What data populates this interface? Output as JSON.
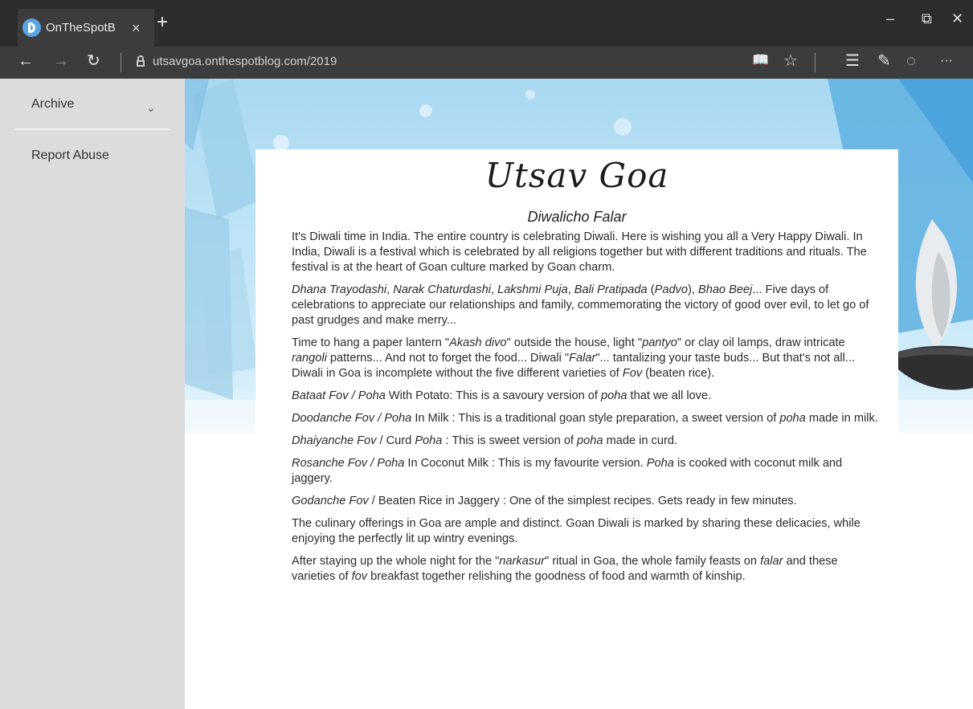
{
  "browser": {
    "tab_title": "OnTheSpotB",
    "tab_close": "×",
    "new_tab": "+",
    "url": "utsavgoa.onthespotblog.com/2019",
    "controls": {
      "minimize": "–",
      "restore": "⧉",
      "close": "✕"
    },
    "nav": {
      "back": "←",
      "forward": "→",
      "refresh": "↻"
    },
    "toolbar": {
      "reading_view": "📖",
      "favorite": "☆",
      "hub": "☰",
      "notes": "✎",
      "share": "◌",
      "more": "···"
    }
  },
  "sidebar": {
    "archive": "Archive",
    "archive_chevron": "⌄",
    "report_abuse": "Report Abuse"
  },
  "blog": {
    "title": "Utsav Goa",
    "subtitle": "Diwalicho Falar"
  },
  "article": {
    "p1": "It's Diwali time in India. The entire country is celebrating Diwali. Here is wishing you all a Very Happy Diwali. In India, Diwali is a festival which is celebrated by all religions together but with different traditions and rituals. The festival is at the heart of Goan culture marked by Goan charm.",
    "p2": {
      "t1": "Dhana Trayodashi",
      "s1": ", ",
      "t2": "Narak Chaturdashi",
      "s2": ", ",
      "t3": "Lakshmi Puja",
      "s3": ", ",
      "t4": "Bali Pratipada",
      "s4": " (",
      "t5": "Padvo",
      "s5": "), ",
      "t6": "Bhao Beej",
      "s6": "... Five days of celebrations to appreciate our relationships and family, commemorating the victory of good over evil, to let go of past grudges and make merry..."
    },
    "p3": {
      "s1": "Time to hang a paper lantern \"",
      "i1": "Akash divo",
      "s2": "\" outside the house, light \"",
      "i2": "pantyo",
      "s3": "\" or clay oil lamps, draw intricate ",
      "i3": "rangoli",
      "s4": " patterns... And not to forget the food... Diwali \"",
      "i4": "Falar",
      "s5": "\"... tantalizing your taste buds... But that's not all... Diwali in Goa is incomplete without the five different varieties of ",
      "i5": "Fov",
      "s6": " (beaten rice)."
    },
    "p4": {
      "i1": "Bataat Fov / Poha",
      "s1": " With Potato: This is a savoury version of ",
      "i2": "poha",
      "s2": " that we all love."
    },
    "p5": {
      "i1": "Doodanche Fov / Poha",
      "s1": " In Milk : This is a traditional goan style preparation, a sweet version of ",
      "i2": "poha",
      "s2": " made in milk."
    },
    "p6": {
      "i1": "Dhaiyanche Fov",
      "s1": " / Curd ",
      "i2": "Poha",
      "s2": " : This is sweet version of ",
      "i3": "poha",
      "s3": " made in curd."
    },
    "p7": {
      "i1": "Rosanche Fov / Poha",
      "s1": " In Coconut Milk : This is my favourite version. ",
      "i2": "Poha",
      "s2": " is cooked with coconut milk and jaggery."
    },
    "p8": {
      "i1": "Godanche Fov",
      "s1": " / Beaten Rice in Jaggery : One of the simplest recipes. Gets ready in few minutes."
    },
    "p9": "The culinary offerings in Goa are ample and distinct. Goan Diwali is marked by sharing these delicacies, while enjoying the perfectly lit up wintry evenings.",
    "p10": {
      "s1": "After staying up the whole night for the \"",
      "i1": "narkasur",
      "s2": "\" ritual in Goa, the whole family feasts on ",
      "i2": "falar",
      "s3": " and these varieties of ",
      "i3": "fov",
      "s4": " breakfast together relishing the goodness of food and warmth of kinship."
    }
  }
}
